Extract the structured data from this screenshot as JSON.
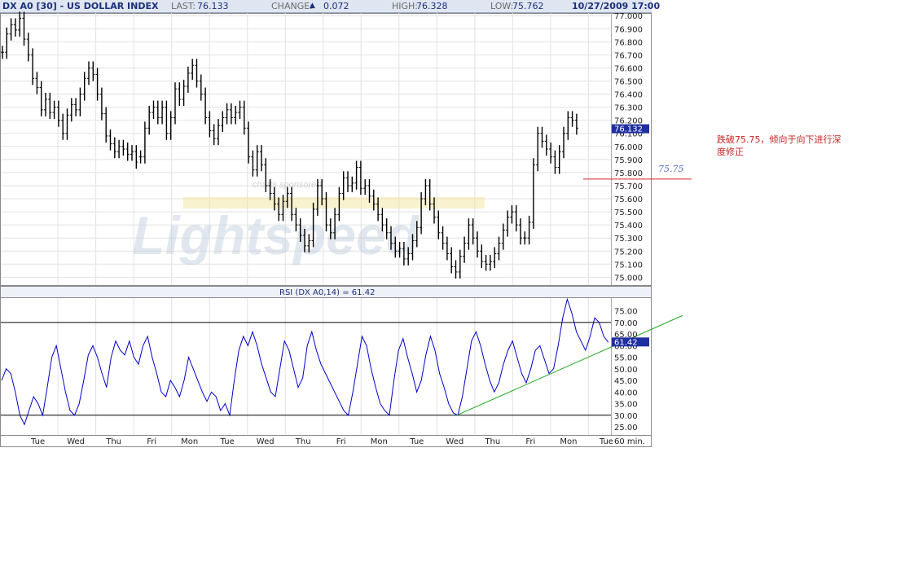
{
  "header": {
    "symbol": "DX A0 [30] - US DOLLAR INDEX",
    "last_label": "LAST:",
    "last_value": "76.133",
    "change_label": "CHANGE:",
    "change_arrow": "▲",
    "change_value": "0.072",
    "high_label": "HIGH:",
    "high_value": "76.328",
    "low_label": "LOW:",
    "low_value": "75.762",
    "datetime": "10/27/2009 17:00"
  },
  "watermark": {
    "sponsor": "charts sponsored",
    "brand": "Lightspeed"
  },
  "annotation": {
    "level_label": "75.75",
    "note_line1": "跌破75.75，倾向于向下进行深",
    "note_line2": "度修正"
  },
  "colors": {
    "price": "#000000",
    "rsi": "#0000cc",
    "trendline": "#22aa22",
    "annotation_line": "#d22222",
    "annotation_text": "#cc2222",
    "level_text": "#5566cc",
    "marker_bg": "#1f2fa0",
    "grid": "#e2e2e2"
  },
  "chart_data": [
    {
      "type": "bar",
      "style": "ohlc",
      "title": "DX A0 [30] - US DOLLAR INDEX",
      "interval": "60 min.",
      "xlabel": "",
      "ylabel": "",
      "ylim": [
        74.94,
        77.02
      ],
      "y_ticks": [
        "77.000",
        "76.900",
        "76.800",
        "76.700",
        "76.600",
        "76.500",
        "76.400",
        "76.300",
        "76.200",
        "76.100",
        "76.000",
        "75.900",
        "75.800",
        "75.700",
        "75.600",
        "75.500",
        "75.400",
        "75.300",
        "75.200",
        "75.100",
        "75.000"
      ],
      "x_ticks": [
        "Tue",
        "Wed",
        "Thu",
        "Fri",
        "Mon",
        "Tue",
        "Wed",
        "Thu",
        "Fri",
        "Mon",
        "Tue",
        "Wed",
        "Thu",
        "Fri",
        "Mon",
        "Tue"
      ],
      "last_marker": "76.132",
      "grid": true,
      "segments": [
        {
          "start": 0,
          "values": [
            76.72,
            76.86,
            76.93,
            76.89,
            76.98,
            76.82,
            76.7,
            76.52,
            76.45,
            76.28,
            76.36,
            76.26,
            76.3,
            76.2,
            76.1,
            76.24,
            76.32,
            76.28,
            76.4,
            76.52,
            76.6,
            76.55,
            76.4,
            76.25,
            76.08,
            76.02,
            75.96,
            76.0,
            75.98,
            75.94,
            75.96,
            75.88
          ]
        },
        {
          "start": 32,
          "values": [
            75.92,
            76.14,
            76.26,
            76.3,
            76.22,
            76.3,
            76.1,
            76.22,
            76.44,
            76.36,
            76.46,
            76.56,
            76.62,
            76.5,
            76.4,
            76.22,
            76.12,
            76.06,
            76.16,
            76.22,
            76.28,
            76.22,
            76.26,
            76.3,
            76.14,
            75.92,
            75.82,
            75.96,
            75.86,
            75.7,
            75.64,
            75.56,
            75.48,
            75.58,
            75.64,
            75.48,
            75.4,
            75.32,
            75.24,
            75.28,
            75.52,
            75.7,
            75.6,
            75.4,
            75.34,
            75.48,
            75.64,
            75.76,
            75.7,
            75.72,
            75.84,
            75.68,
            75.7,
            75.62,
            75.56,
            75.48,
            75.4,
            75.34,
            75.26,
            75.2,
            75.22,
            75.14,
            75.18,
            75.28,
            75.38,
            75.6,
            75.7,
            75.56,
            75.46,
            75.34,
            75.26,
            75.18,
            75.08,
            75.04,
            75.16,
            75.26,
            75.4,
            75.3,
            75.2,
            75.12,
            75.1,
            75.12,
            75.18,
            75.26,
            75.36,
            75.46,
            75.5,
            75.4,
            75.3,
            75.3,
            75.42,
            75.86,
            76.1,
            76.04,
            75.98,
            75.92,
            75.84,
            75.96,
            76.1,
            76.22,
            76.2,
            76.14
          ]
        }
      ]
    },
    {
      "type": "line",
      "title": "RSI (DX A0,14) = 61.42",
      "xlabel": "",
      "ylabel": "",
      "ylim": [
        21.5,
        80.5
      ],
      "y_ticks": [
        "75.00",
        "70.00",
        "65.00",
        "60.00",
        "55.00",
        "50.00",
        "45.00",
        "40.00",
        "35.00",
        "30.00",
        "25.00"
      ],
      "x_ticks": [
        "Tue",
        "Wed",
        "Thu",
        "Fri",
        "Mon",
        "Tue",
        "Wed",
        "Thu",
        "Fri",
        "Mon",
        "Tue"
      ],
      "reference_lines": [
        70,
        30
      ],
      "last_marker": "61.42",
      "trendline": {
        "from_x": 151,
        "from_y": 30,
        "to_x": 237,
        "to_y": 73
      },
      "values": [
        45,
        50,
        48,
        40,
        30,
        26,
        32,
        38,
        35,
        30,
        42,
        55,
        60,
        50,
        40,
        32,
        30,
        35,
        45,
        56,
        60,
        55,
        48,
        42,
        55,
        62,
        58,
        56,
        62,
        55,
        52,
        60,
        64,
        55,
        48,
        40,
        38,
        45,
        42,
        38,
        45,
        55,
        50,
        45,
        40,
        36,
        40,
        38,
        32,
        35,
        30,
        45,
        58,
        64,
        60,
        66,
        60,
        52,
        46,
        40,
        38,
        50,
        62,
        58,
        50,
        42,
        46,
        60,
        66,
        58,
        52,
        48,
        44,
        40,
        36,
        32,
        30,
        40,
        52,
        64,
        60,
        50,
        42,
        35,
        32,
        30,
        45,
        58,
        63,
        55,
        48,
        40,
        45,
        56,
        64,
        58,
        48,
        42,
        35,
        31,
        30,
        38,
        50,
        62,
        66,
        60,
        52,
        45,
        40,
        44,
        52,
        58,
        62,
        55,
        48,
        44,
        50,
        58,
        60,
        54,
        48,
        50,
        60,
        72,
        80,
        74,
        66,
        62,
        58,
        64,
        72,
        70,
        64,
        61.42
      ]
    }
  ]
}
